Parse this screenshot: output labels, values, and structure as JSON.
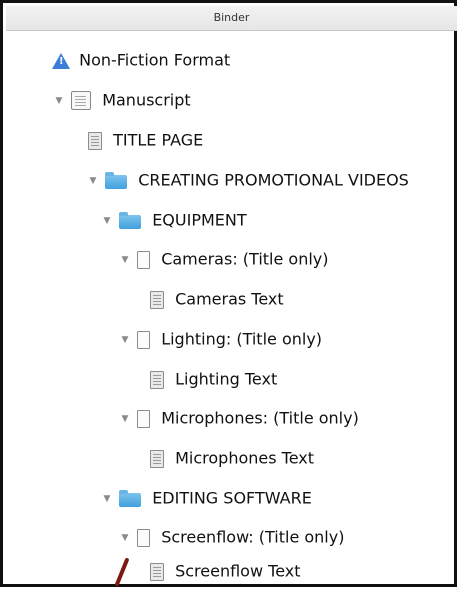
{
  "panel": {
    "title": "Binder"
  },
  "items": [
    {
      "label": "Non-Fiction Format",
      "icon": "warning-icon"
    },
    {
      "label": "Manuscript",
      "icon": "manuscript-icon"
    },
    {
      "label": "TITLE PAGE",
      "icon": "document-icon"
    },
    {
      "label": "CREATING PROMOTIONAL VIDEOS",
      "icon": "folder-icon"
    },
    {
      "label": "EQUIPMENT",
      "icon": "folder-icon"
    },
    {
      "label": "Cameras: (Title only)",
      "icon": "blank-page-icon"
    },
    {
      "label": "Cameras Text",
      "icon": "document-icon"
    },
    {
      "label": "Lighting: (Title only)",
      "icon": "blank-page-icon"
    },
    {
      "label": "Lighting Text",
      "icon": "document-icon"
    },
    {
      "label": "Microphones: (Title only)",
      "icon": "blank-page-icon"
    },
    {
      "label": "Microphones Text",
      "icon": "document-icon"
    },
    {
      "label": "EDITING SOFTWARE",
      "icon": "folder-icon"
    },
    {
      "label": "Screenflow: (Title only)",
      "icon": "blank-page-icon"
    },
    {
      "label": "Screenflow Text",
      "icon": "document-icon"
    }
  ],
  "colors": {
    "folder": "#3fa0dc",
    "warning": "#3b7dd8",
    "text": "#111111"
  }
}
